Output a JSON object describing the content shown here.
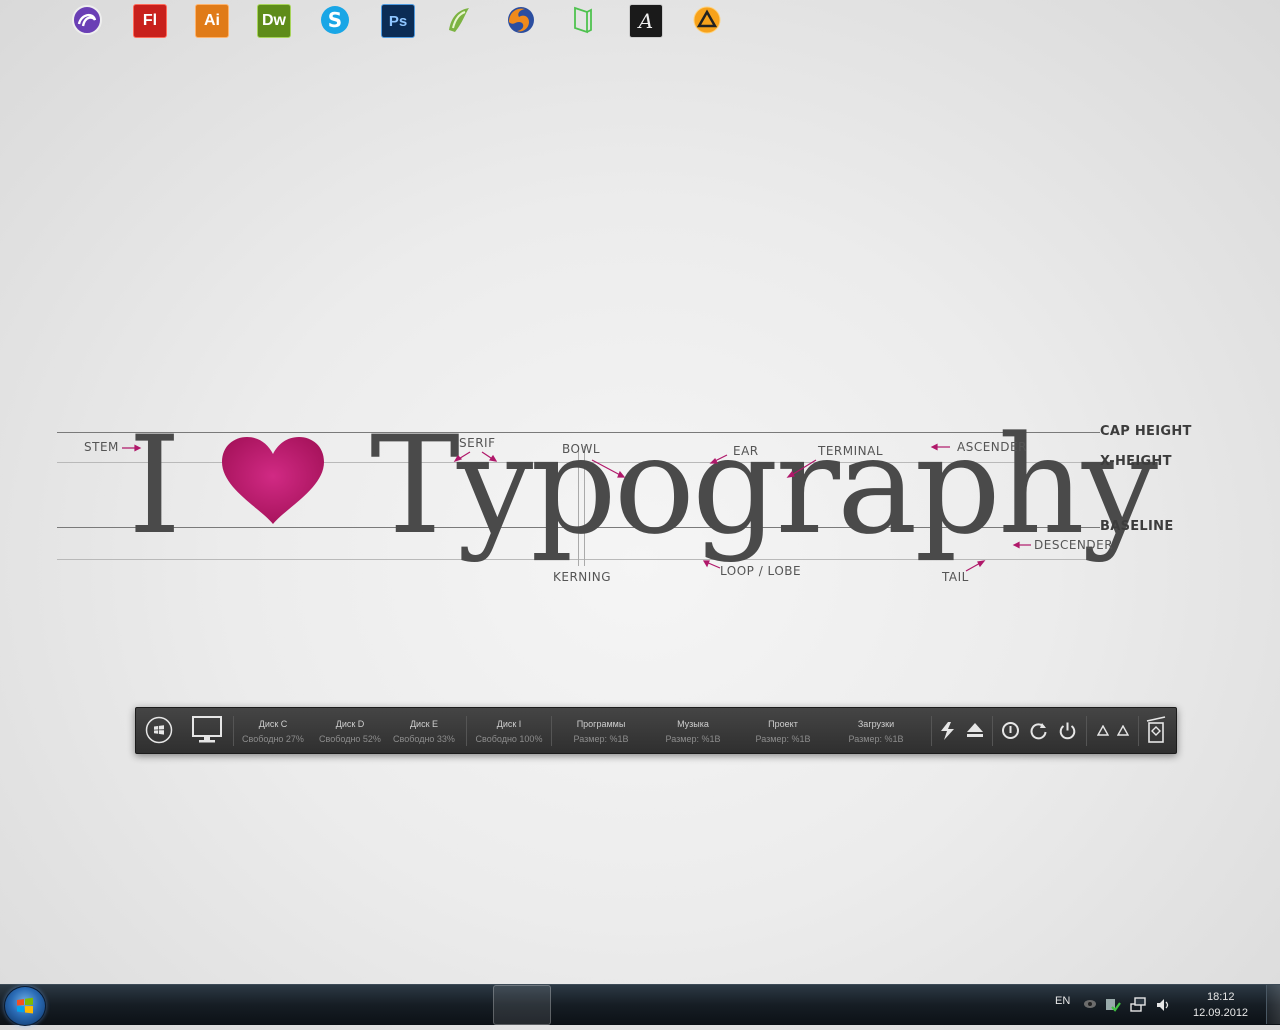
{
  "wallpaper": {
    "letter_i": "I",
    "word": "Typography",
    "heart_color": "#c2186d",
    "labels": {
      "stem": "STEM",
      "serif": "SERIF",
      "bowl": "BOWL",
      "ear": "EAR",
      "terminal": "TERMINAL",
      "ascender": "ASCENDER",
      "kerning": "KERNING",
      "loop_lobe": "LOOP / LOBE",
      "tail": "TAIL",
      "descender": "DESCENDER"
    },
    "lines": {
      "cap_height": "CAP HEIGHT",
      "x_height": "X-HEIGHT",
      "baseline": "BASELINE"
    }
  },
  "dock": {
    "drives": [
      {
        "name": "Диск C",
        "free": "Свободно 27%"
      },
      {
        "name": "Диск D",
        "free": "Свободно 52%"
      },
      {
        "name": "Диск E",
        "free": "Свободно 33%"
      },
      {
        "name": "Диск  I",
        "free": "Свободно 100%"
      }
    ],
    "folders": [
      {
        "name": "Программы",
        "size": "Размер: %1B"
      },
      {
        "name": "Музыка",
        "size": "Размер: %1B"
      },
      {
        "name": "Проект",
        "size": "Размер: %1B"
      },
      {
        "name": "Загрузки",
        "size": "Размер: %1B"
      }
    ]
  },
  "taskbar": {
    "apps": [
      {
        "icon": "bittorrent-icon",
        "label": ""
      },
      {
        "icon": "flash-icon",
        "label": "Fl",
        "color": "#c8201c"
      },
      {
        "icon": "illustrator-icon",
        "label": "Ai",
        "color": "#e07b18"
      },
      {
        "icon": "dreamweaver-icon",
        "label": "Dw",
        "color": "#5e8c1a"
      },
      {
        "icon": "skype-icon",
        "label": "S",
        "color": "#19a6e6"
      },
      {
        "icon": "photoshop-icon",
        "label": "Ps",
        "color": "#1a5fa8"
      },
      {
        "icon": "coreldraw-icon",
        "label": "",
        "color": "#7cb342"
      },
      {
        "icon": "firefox-icon",
        "label": ""
      },
      {
        "icon": "notebook-icon",
        "label": ""
      },
      {
        "icon": "font-viewer-icon",
        "label": "A"
      },
      {
        "icon": "aimp-icon",
        "label": ""
      }
    ],
    "language": "EN",
    "time": "18:12",
    "date": "12.09.2012"
  }
}
